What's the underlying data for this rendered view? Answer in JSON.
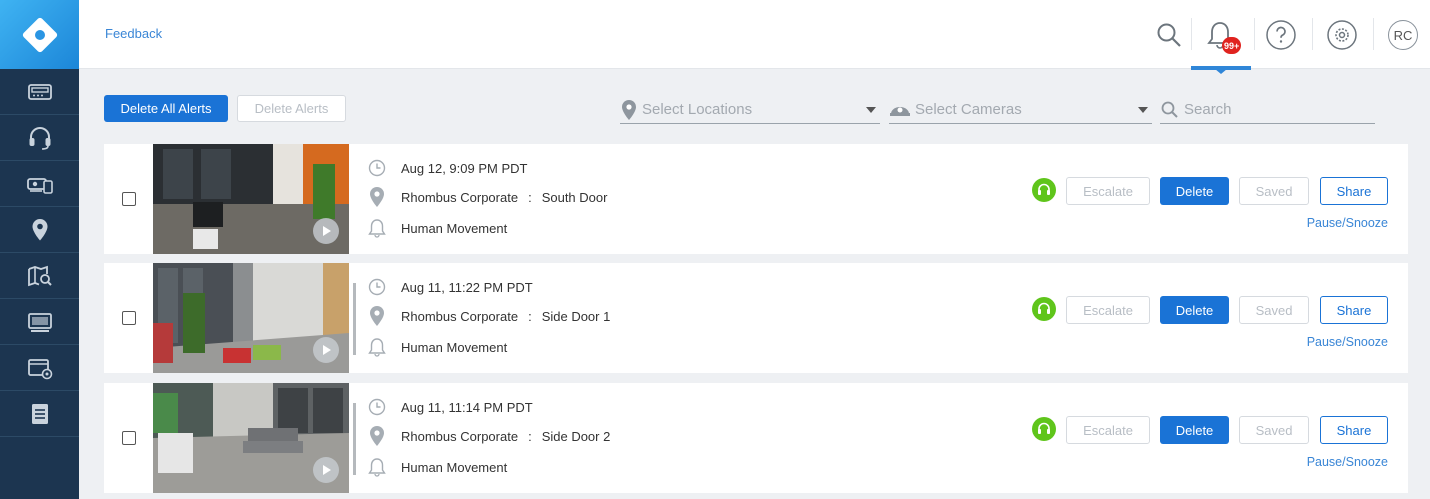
{
  "header": {
    "feedback_label": "Feedback",
    "notification_badge": "99+",
    "avatar_initials": "RC"
  },
  "sidebar": {
    "items": [
      {
        "icon": "video-recorder-icon"
      },
      {
        "icon": "headset-icon"
      },
      {
        "icon": "devices-icon"
      },
      {
        "icon": "location-pin-icon"
      },
      {
        "icon": "map-search-icon"
      },
      {
        "icon": "monitor-icon"
      },
      {
        "icon": "video-settings-icon"
      },
      {
        "icon": "document-icon"
      }
    ]
  },
  "toolbar": {
    "delete_all_label": "Delete All Alerts",
    "delete_label": "Delete Alerts",
    "locations_placeholder": "Select Locations",
    "cameras_placeholder": "Select Cameras",
    "search_placeholder": "Search"
  },
  "alerts": [
    {
      "timestamp": "Aug 12, 9:09 PM PDT",
      "location": "Rhombus Corporate",
      "location_sep": ":",
      "camera": "South Door",
      "event": "Human Movement",
      "escalate_label": "Escalate",
      "delete_label": "Delete",
      "saved_label": "Saved",
      "share_label": "Share",
      "pause_label": "Pause/Snooze"
    },
    {
      "timestamp": "Aug 11, 11:22 PM PDT",
      "location": "Rhombus Corporate",
      "location_sep": ":",
      "camera": "Side Door 1",
      "event": "Human Movement",
      "escalate_label": "Escalate",
      "delete_label": "Delete",
      "saved_label": "Saved",
      "share_label": "Share",
      "pause_label": "Pause/Snooze"
    },
    {
      "timestamp": "Aug 11, 11:14 PM PDT",
      "location": "Rhombus Corporate",
      "location_sep": ":",
      "camera": "Side Door 2",
      "event": "Human Movement",
      "escalate_label": "Escalate",
      "delete_label": "Delete",
      "saved_label": "Saved",
      "share_label": "Share",
      "pause_label": "Pause/Snooze"
    }
  ],
  "colors": {
    "sidebar": "#1c3550",
    "accent": "#1a73d6",
    "support_green": "#5fc51b",
    "badge_red": "#e0231f"
  }
}
